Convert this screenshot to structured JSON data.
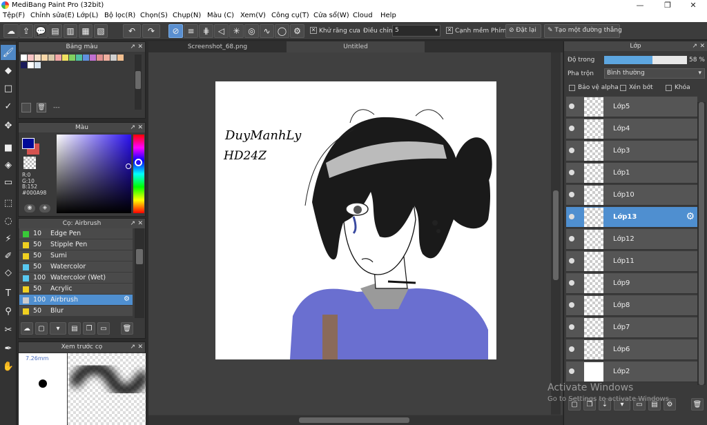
{
  "window": {
    "title": "MediBang Paint Pro (32bit)"
  },
  "menu": [
    "Tệp(F)",
    "Chỉnh sửa(E)",
    "Lớp(L)",
    "Bộ lọc(R)",
    "Chọn(S)",
    "Chụp(N)",
    "Màu (C)",
    "Xem(V)",
    "Công cụ(T)",
    "Cửa sổ(W)",
    "Cloud",
    "Help"
  ],
  "toolbar": {
    "antialias_label": "Khử răng cưa",
    "correction_label": "Điều chỉnh",
    "correction_value": "5",
    "edge_label": "Cạnh mềm",
    "key_label": "Phím",
    "reset_label": "Đặt lại",
    "create_line_label": "Tạo một đường thẳng"
  },
  "palette_panel": {
    "title": "Bảng màu",
    "dash": "---"
  },
  "color_panel": {
    "title": "Màu",
    "r": "R:0",
    "g": "G:10",
    "b": "B:152",
    "hex": "#000A98",
    "primary_color": "#000a98",
    "secondary_color": "#d4524f"
  },
  "brush_panel": {
    "title": "Cọ: Airbrush",
    "brushes": [
      {
        "size": "10",
        "name": "Edge Pen",
        "color": "#38c838"
      },
      {
        "size": "50",
        "name": "Stipple Pen",
        "color": "#f0d020"
      },
      {
        "size": "50",
        "name": "Sumi",
        "color": "#f0d020"
      },
      {
        "size": "50",
        "name": "Watercolor",
        "color": "#58c8f0"
      },
      {
        "size": "100",
        "name": "Watercolor (Wet)",
        "color": "#58c8f0"
      },
      {
        "size": "50",
        "name": "Acrylic",
        "color": "#f0d020"
      },
      {
        "size": "100",
        "name": "Airbrush",
        "color": "#cccccc"
      },
      {
        "size": "50",
        "name": "Blur",
        "color": "#f0d020"
      }
    ]
  },
  "preview_panel": {
    "title": "Xem trước cọ",
    "size": "7.26mm"
  },
  "tabs": [
    "Screenshot_68.png",
    "Untitled"
  ],
  "canvas": {
    "signature_line1": "DuyManhLy",
    "signature_line2": "HD24Z"
  },
  "layer_panel": {
    "title": "Lớp",
    "opacity_label": "Độ trong",
    "opacity_value": "58 %",
    "opacity_fraction": 0.58,
    "blend_label": "Pha trộn",
    "blend_value": "Bình thường",
    "protect_alpha": "Bảo vệ alpha",
    "clipping": "Xén bớt",
    "lock": "Khóa",
    "layers": [
      "Lớp5",
      "Lớp4",
      "Lớp3",
      "Lớp1",
      "Lớp10",
      "Lớp13",
      "Lớp12",
      "Lớp11",
      "Lớp9",
      "Lớp8",
      "Lớp7",
      "Lớp6",
      "Lớp2"
    ]
  },
  "watermark": {
    "line1": "Activate Windows",
    "line2": "Go to Settings to activate Windows."
  }
}
